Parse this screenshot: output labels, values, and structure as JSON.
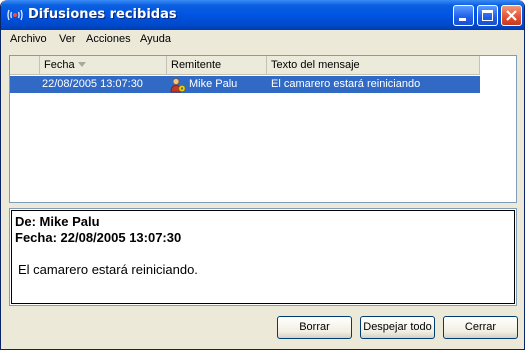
{
  "window": {
    "title": "Difusiones recibidas",
    "controls": {
      "minimize": "minimize-icon",
      "maximize": "maximize-icon",
      "close": "close-icon"
    }
  },
  "menu": [
    "Archivo",
    "Ver",
    "Acciones",
    "Ayuda"
  ],
  "list": {
    "columns": [
      "Fecha",
      "Remitente",
      "Texto del mensaje"
    ],
    "sort_column": "Fecha",
    "sort_direction": "descending",
    "rows": [
      {
        "fecha": "22/08/2005 13:07:30",
        "remitente": "Mike Palu",
        "texto": "El camarero estará reiniciando",
        "selected": true
      }
    ]
  },
  "preview": {
    "from": "De: Mike Palu",
    "date": "Fecha: 22/08/2005 13:07:30",
    "body": "El camarero estará reiniciando."
  },
  "buttons": {
    "delete": "Borrar",
    "clear_all": "Despejar todo",
    "close": "Cerrar"
  },
  "colors": {
    "titlebar": "#0054e3",
    "selection": "#316ac5",
    "face": "#ece9d8"
  }
}
